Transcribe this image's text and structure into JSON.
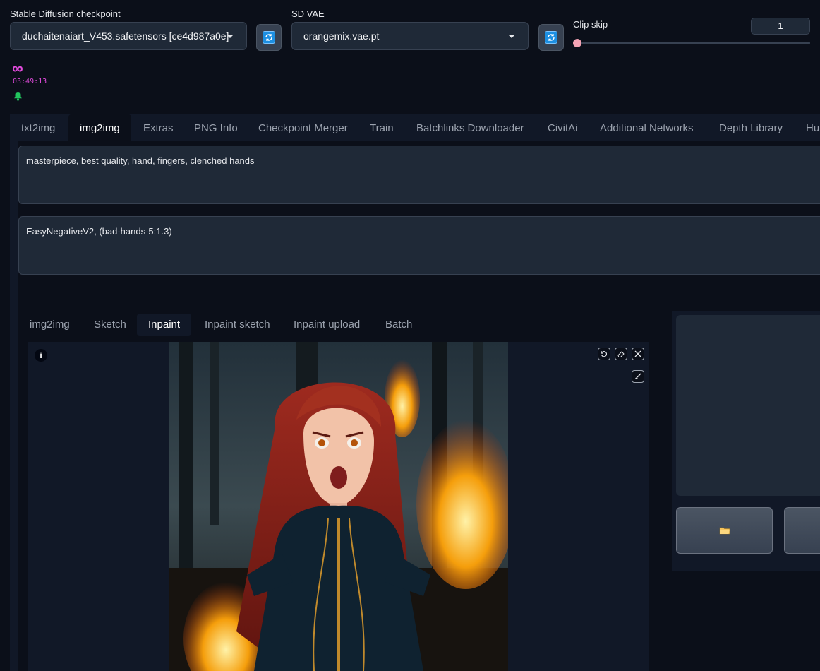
{
  "settings": {
    "checkpoint": {
      "label": "Stable Diffusion checkpoint",
      "value": "duchaitenaiart_V453.safetensors [ce4d987a0e]"
    },
    "vae": {
      "label": "SD VAE",
      "value": "orangemix.vae.pt"
    },
    "clip_skip": {
      "label": "Clip skip",
      "value": "1",
      "level": 0.0
    }
  },
  "status": {
    "infinity_symbol": "∞",
    "timer": "03:49:13"
  },
  "main_tabs": [
    "txt2img",
    "img2img",
    "Extras",
    "PNG Info",
    "Checkpoint Merger",
    "Train",
    "Batchlinks Downloader",
    "CivitAi",
    "Additional Networks",
    "Depth Library",
    "Hu"
  ],
  "active_main_tab": "img2img",
  "prompt": {
    "positive": "masterpiece, best quality, hand, fingers, clenched hands",
    "negative": "EasyNegativeV2, (bad-hands-5:1.3)"
  },
  "sub_tabs": [
    "img2img",
    "Sketch",
    "Inpaint",
    "Inpaint sketch",
    "Inpaint upload",
    "Batch"
  ],
  "active_sub_tab": "Inpaint",
  "canvas": {
    "info_glyph": "i"
  },
  "colors": {
    "background": "#0b0f19",
    "accent_refresh": "#1d8fe1",
    "slider_thumb": "#f4a3b4",
    "infinity": "#e14bdc",
    "bell": "#22c55e"
  },
  "icons": [
    "refresh-icon",
    "infinity-icon",
    "bell-icon",
    "undo-icon",
    "eraser-icon",
    "close-icon",
    "brush-icon",
    "folder-icon"
  ]
}
